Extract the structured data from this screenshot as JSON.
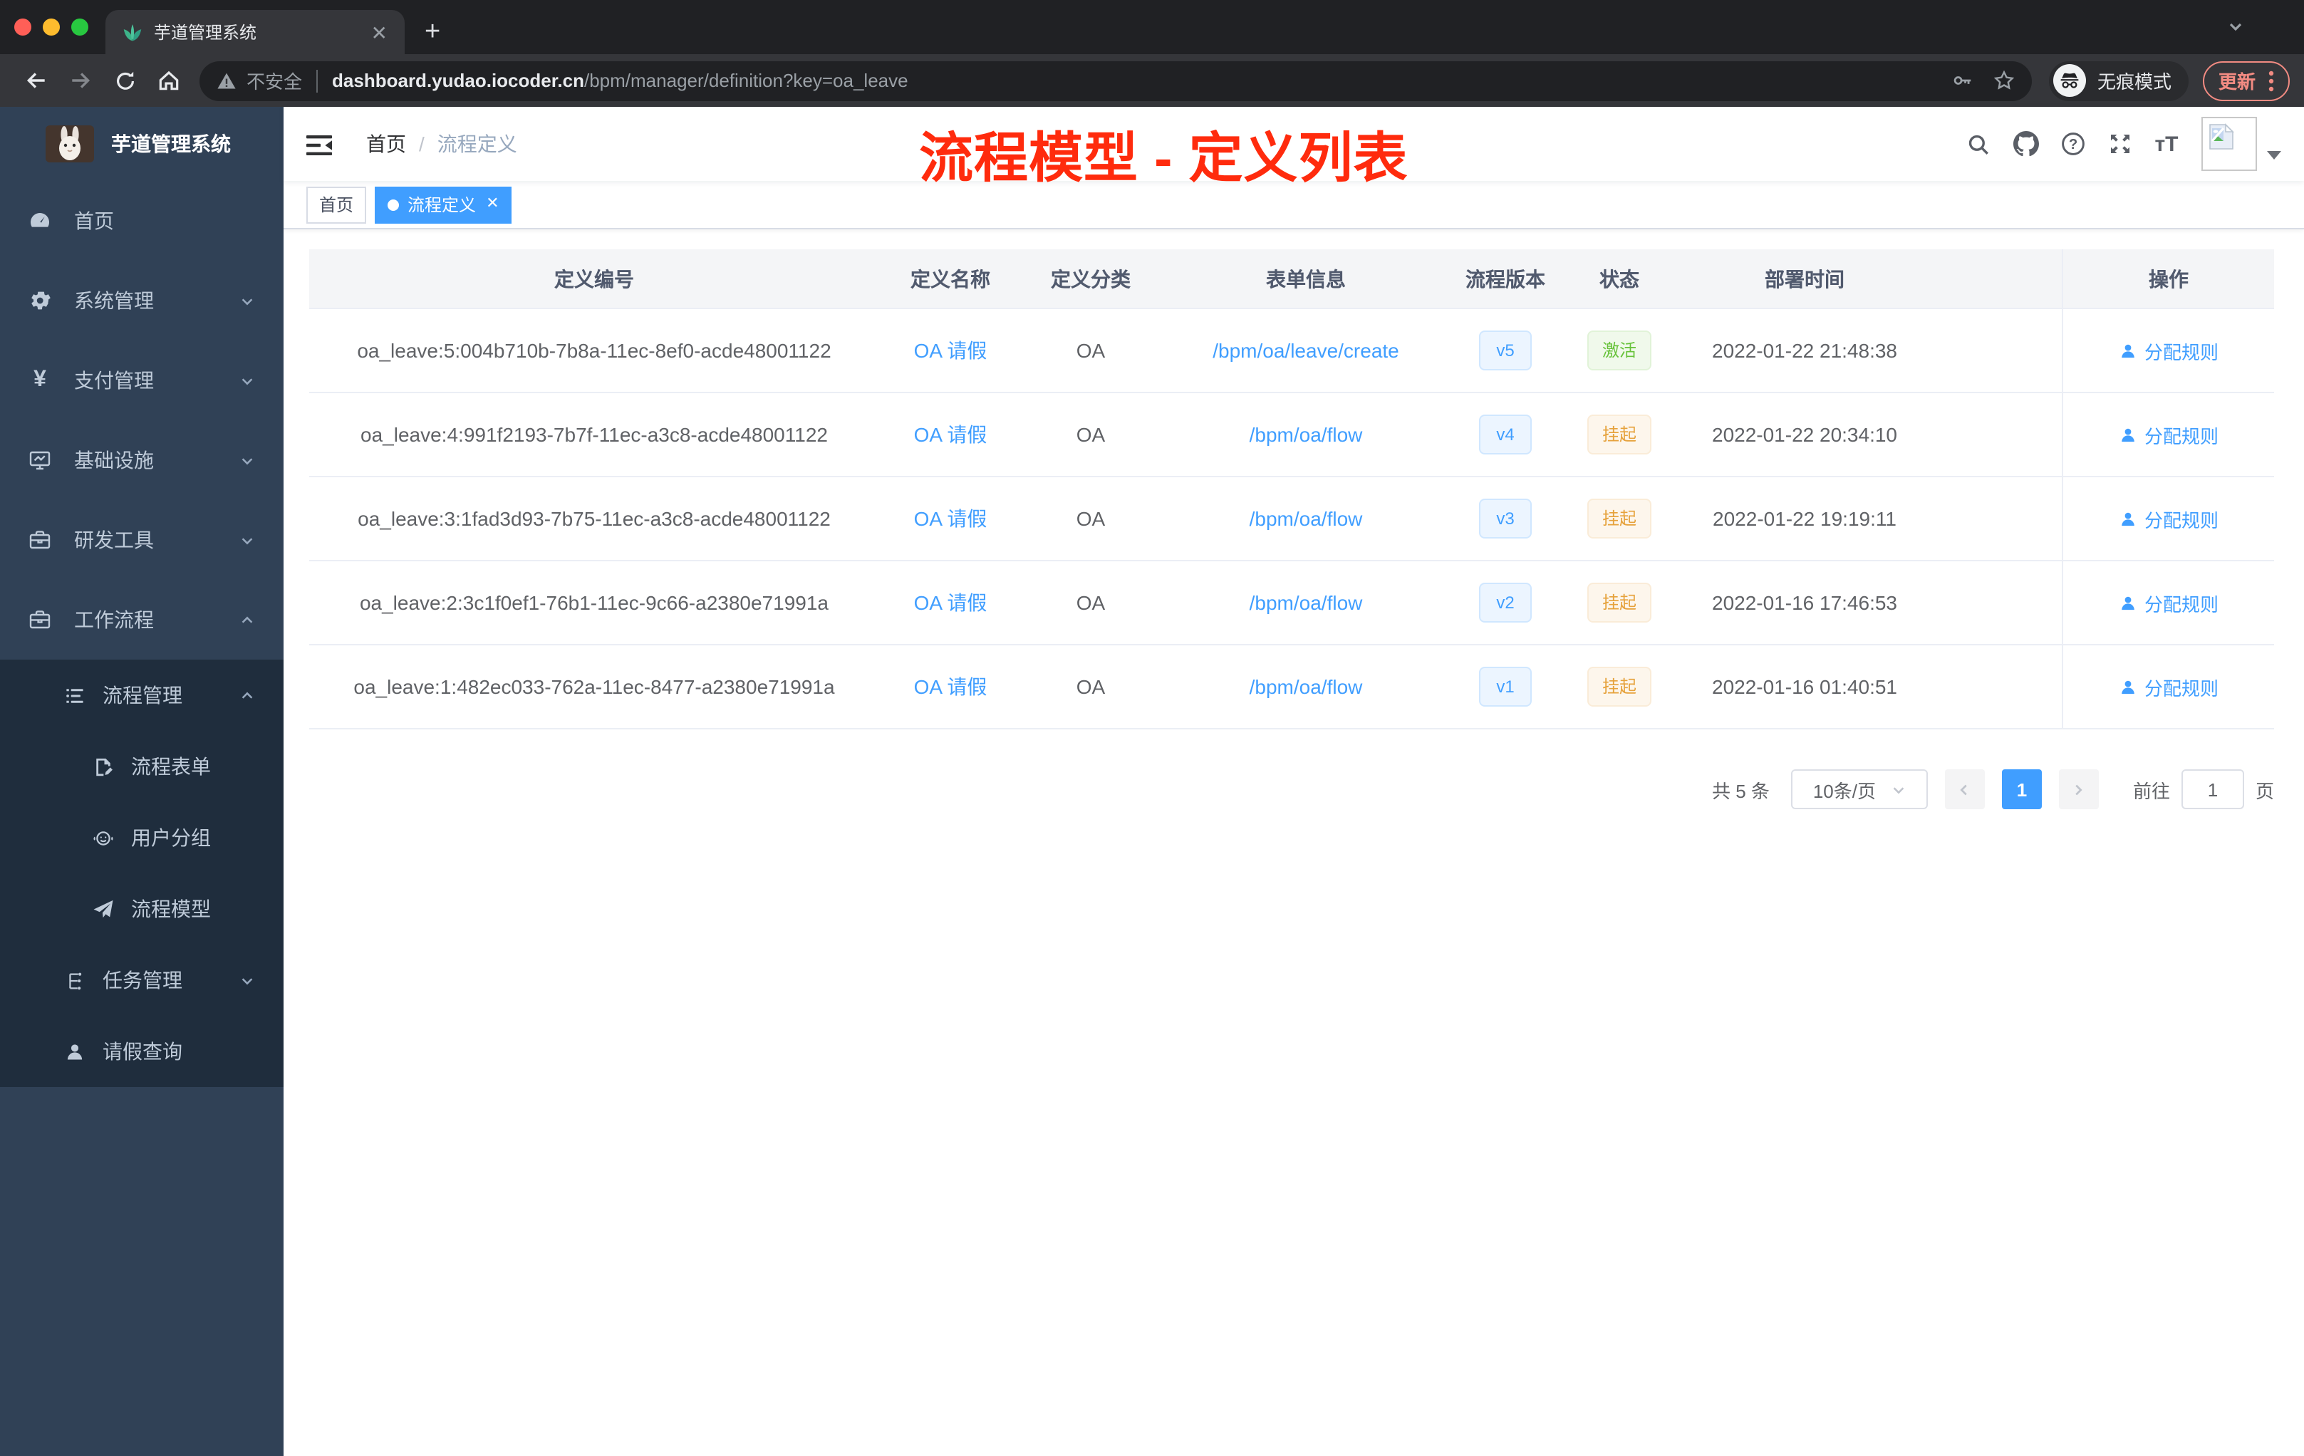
{
  "colors": {
    "accent": "#409EFF",
    "success": "#67C23A",
    "warning": "#E6A23C",
    "annotation_red": "#FF2B0D",
    "sidebar_bg": "#304156",
    "submenu_bg": "#1F2D3D"
  },
  "browser": {
    "tab_title": "芋道管理系统",
    "security_label": "不安全",
    "url_domain": "dashboard.yudao.iocoder.cn",
    "url_path": "/bpm/manager/definition?key=oa_leave",
    "incognito_label": "无痕模式",
    "update_label": "更新"
  },
  "sidebar": {
    "app_title": "芋道管理系统",
    "menu": [
      {
        "label": "首页"
      },
      {
        "label": "系统管理"
      },
      {
        "label": "支付管理"
      },
      {
        "label": "基础设施"
      },
      {
        "label": "研发工具"
      },
      {
        "label": "工作流程"
      }
    ],
    "submenu": [
      {
        "label": "流程管理"
      },
      {
        "label": "流程表单"
      },
      {
        "label": "用户分组"
      },
      {
        "label": "流程模型"
      },
      {
        "label": "任务管理"
      },
      {
        "label": "请假查询"
      }
    ]
  },
  "navbar": {
    "breadcrumb": [
      "首页",
      "流程定义"
    ],
    "breadcrumb_separator": "/",
    "annotation": "流程模型 - 定义列表"
  },
  "tags": [
    {
      "label": "首页"
    },
    {
      "label": "流程定义"
    }
  ],
  "table": {
    "columns": [
      "定义编号",
      "定义名称",
      "定义分类",
      "表单信息",
      "流程版本",
      "状态",
      "部署时间",
      "操作"
    ],
    "rows": [
      {
        "id": "oa_leave:5:004b710b-7b8a-11ec-8ef0-acde48001122",
        "name": "OA 请假",
        "category": "OA",
        "form": "/bpm/oa/leave/create",
        "version": "v5",
        "status": "激活",
        "status_type": "success",
        "time": "2022-01-22 21:48:38",
        "action": "分配规则"
      },
      {
        "id": "oa_leave:4:991f2193-7b7f-11ec-a3c8-acde48001122",
        "name": "OA 请假",
        "category": "OA",
        "form": "/bpm/oa/flow",
        "version": "v4",
        "status": "挂起",
        "status_type": "warning",
        "time": "2022-01-22 20:34:10",
        "action": "分配规则"
      },
      {
        "id": "oa_leave:3:1fad3d93-7b75-11ec-a3c8-acde48001122",
        "name": "OA 请假",
        "category": "OA",
        "form": "/bpm/oa/flow",
        "version": "v3",
        "status": "挂起",
        "status_type": "warning",
        "time": "2022-01-22 19:19:11",
        "action": "分配规则"
      },
      {
        "id": "oa_leave:2:3c1f0ef1-76b1-11ec-9c66-a2380e71991a",
        "name": "OA 请假",
        "category": "OA",
        "form": "/bpm/oa/flow",
        "version": "v2",
        "status": "挂起",
        "status_type": "warning",
        "time": "2022-01-16 17:46:53",
        "action": "分配规则"
      },
      {
        "id": "oa_leave:1:482ec033-762a-11ec-8477-a2380e71991a",
        "name": "OA 请假",
        "category": "OA",
        "form": "/bpm/oa/flow",
        "version": "v1",
        "status": "挂起",
        "status_type": "warning",
        "time": "2022-01-16 01:40:51",
        "action": "分配规则"
      }
    ]
  },
  "pagination": {
    "total": "共 5 条",
    "page_size": "10条/页",
    "current": "1",
    "goto_label": "前往",
    "goto_value": "1",
    "page_unit": "页"
  }
}
